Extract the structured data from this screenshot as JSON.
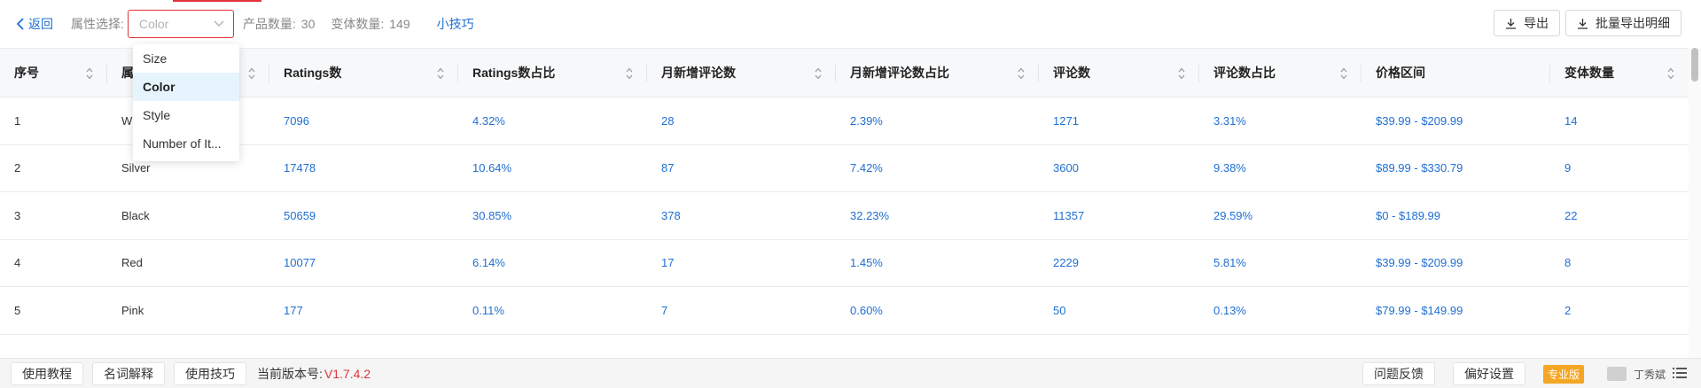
{
  "toolbar": {
    "back_label": "返回",
    "attr_label": "属性选择:",
    "attr_value": "Color",
    "product_count_label": "产品数量:",
    "product_count": "30",
    "variant_count_label": "变体数量:",
    "variant_count": "149",
    "tips_label": "小技巧",
    "export_label": "导出",
    "batch_export_label": "批量导出明细"
  },
  "table": {
    "headers": [
      "序号",
      "属",
      "Ratings数",
      "Ratings数占比",
      "月新增评论数",
      "月新增评论数占比",
      "评论数",
      "评论数占比",
      "价格区间",
      "变体数量"
    ],
    "rows": [
      [
        "1",
        "W",
        "7096",
        "4.32%",
        "28",
        "2.39%",
        "1271",
        "3.31%",
        "$39.99 - $209.99",
        "14"
      ],
      [
        "2",
        "Silver",
        "17478",
        "10.64%",
        "87",
        "7.42%",
        "3600",
        "9.38%",
        "$89.99 - $330.79",
        "9"
      ],
      [
        "3",
        "Black",
        "50659",
        "30.85%",
        "378",
        "32.23%",
        "11357",
        "29.59%",
        "$0 - $189.99",
        "22"
      ],
      [
        "4",
        "Red",
        "10077",
        "6.14%",
        "17",
        "1.45%",
        "2229",
        "5.81%",
        "$39.99 - $209.99",
        "8"
      ],
      [
        "5",
        "Pink",
        "177",
        "0.11%",
        "7",
        "0.60%",
        "50",
        "0.13%",
        "$79.99 - $149.99",
        "2"
      ]
    ]
  },
  "dropdown": {
    "options": [
      "Size",
      "Color",
      "Style",
      "Number of It..."
    ],
    "selected_index": 1
  },
  "footer": {
    "tutorial_label": "使用教程",
    "glossary_label": "名词解释",
    "tips_label": "使用技巧",
    "version_label": "当前版本号:",
    "version": "V1.7.4.2",
    "feedback_label": "问题反馈",
    "preferences_label": "偏好设置",
    "pro_badge": "专业版",
    "username": "丁秀斌"
  },
  "colors": {
    "accent_blue": "#1f6fd1",
    "accent_red": "#e0323c",
    "pro_orange": "#f5a623"
  },
  "icons": [
    "chevron-left-icon",
    "chevron-down-icon",
    "download-icon",
    "sort-icon",
    "avatar-icon",
    "menu-icon"
  ]
}
